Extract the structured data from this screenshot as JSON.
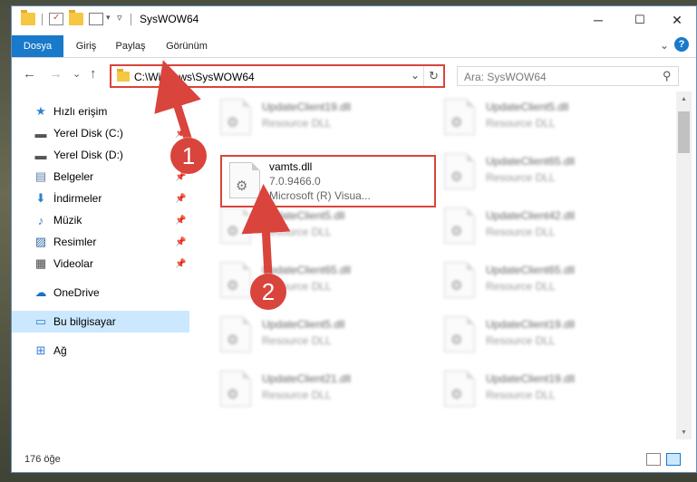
{
  "window": {
    "title": "SysWOW64",
    "minimize": "─",
    "maximize": "☐",
    "close": "✕"
  },
  "ribbon": {
    "tabs": [
      {
        "label": "Dosya"
      },
      {
        "label": "Giriş"
      },
      {
        "label": "Paylaş"
      },
      {
        "label": "Görünüm"
      }
    ],
    "expand_glyph": "⌄",
    "help_glyph": "?"
  },
  "address": {
    "path": "C:\\Windows\\SysWOW64",
    "back": "←",
    "forward": "→",
    "recent": "⌄",
    "up": "↑",
    "dropdown": "⌄",
    "refresh": "↻"
  },
  "search": {
    "placeholder": "Ara: SysWOW64",
    "icon": "⚲"
  },
  "nav": {
    "items": [
      {
        "label": "Hızlı erişim",
        "icon": "star-icon",
        "glyph": "★",
        "color": "#2f7fd2",
        "pinned": false
      },
      {
        "label": "Yerel Disk (C:)",
        "icon": "drive-icon",
        "glyph": "▬",
        "color": "#555555",
        "pinned": true
      },
      {
        "label": "Yerel Disk (D:)",
        "icon": "drive-icon",
        "glyph": "▬",
        "color": "#555555",
        "pinned": true
      },
      {
        "label": "Belgeler",
        "icon": "documents-icon",
        "glyph": "▤",
        "color": "#5b7fa6",
        "pinned": true
      },
      {
        "label": "İndirmeler",
        "icon": "download-icon",
        "glyph": "⬇",
        "color": "#2f7fd2",
        "pinned": true
      },
      {
        "label": "Müzik",
        "icon": "music-icon",
        "glyph": "♪",
        "color": "#2f7fd2",
        "pinned": true
      },
      {
        "label": "Resimler",
        "icon": "pictures-icon",
        "glyph": "▨",
        "color": "#3a6ea8",
        "pinned": true
      },
      {
        "label": "Videolar",
        "icon": "videos-icon",
        "glyph": "▦",
        "color": "#444444",
        "pinned": true
      },
      {
        "label": "OneDrive",
        "icon": "cloud-icon",
        "glyph": "☁",
        "color": "#1d6fc4",
        "pinned": false
      },
      {
        "label": "Bu bilgisayar",
        "icon": "computer-icon",
        "glyph": "▭",
        "color": "#2f7fd2",
        "pinned": false,
        "selected": true
      },
      {
        "label": "Ağ",
        "icon": "network-icon",
        "glyph": "⊞",
        "color": "#2f7fd2",
        "pinned": false
      }
    ],
    "pin_glyph": "📌"
  },
  "files": {
    "featured": {
      "name": "vamts.dll",
      "version": "7.0.9466.0",
      "description": "Microsoft (R) Visua..."
    },
    "left_column": [
      {
        "name": "UpdateClient19.dll",
        "desc": "Resource DLL"
      },
      {
        "name": "UpdateClient5.dll",
        "desc": "Resource DLL"
      },
      {
        "name": "UpdateClient65.dll",
        "desc": "Resource DLL"
      },
      {
        "name": "UpdateClient5.dll",
        "desc": "Resource DLL"
      },
      {
        "name": "UpdateClient21.dll",
        "desc": "Resource DLL"
      }
    ],
    "right_column": [
      {
        "name": "UpdateClient5.dll",
        "desc": "Resource DLL"
      },
      {
        "name": "UpdateClient65.dll",
        "desc": "Resource DLL"
      },
      {
        "name": "UpdateClient42.dll",
        "desc": "Resource DLL"
      },
      {
        "name": "UpdateClient65.dll",
        "desc": "Resource DLL"
      },
      {
        "name": "UpdateClient19.dll",
        "desc": "Resource DLL"
      },
      {
        "name": "UpdateClient19.dll",
        "desc": "Resource DLL"
      }
    ],
    "gear_glyph": "⚙"
  },
  "status": {
    "count": "176 öğe"
  },
  "annotations": {
    "badge1": "1",
    "badge2": "2",
    "color": "#d9443c"
  }
}
